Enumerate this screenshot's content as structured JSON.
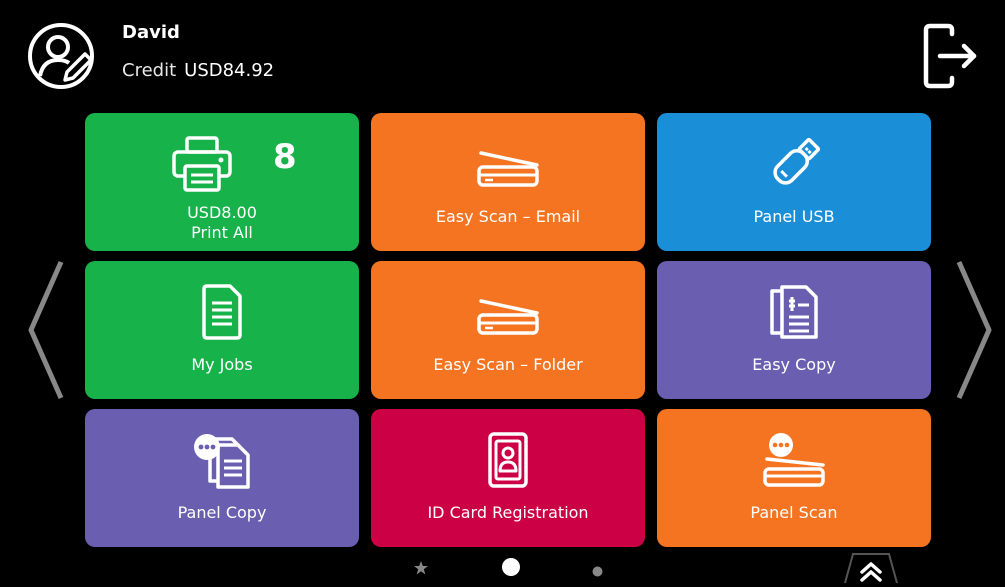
{
  "header": {
    "user_name": "David",
    "credit_label": "Credit",
    "credit_value": "USD84.92",
    "icons": {
      "avatar": "user-edit-icon",
      "logout": "logout-icon"
    }
  },
  "tiles": [
    {
      "id": "print-all",
      "line1": "USD8.00",
      "line2": "Print All",
      "badge": "8",
      "icon": "printer-icon",
      "color": "#17b34a"
    },
    {
      "id": "easy-scan-email",
      "label": "Easy Scan – Email",
      "icon": "scanner-icon",
      "color": "#f47421"
    },
    {
      "id": "panel-usb",
      "label": "Panel USB",
      "icon": "usb-drive-icon",
      "color": "#1b8ed8"
    },
    {
      "id": "my-jobs",
      "label": "My Jobs",
      "icon": "document-icon",
      "color": "#17b34a"
    },
    {
      "id": "easy-scan-folder",
      "label": "Easy Scan – Folder",
      "icon": "scanner-icon",
      "color": "#f47421"
    },
    {
      "id": "easy-copy",
      "label": "Easy Copy",
      "icon": "copy-documents-icon",
      "color": "#6a5eb0"
    },
    {
      "id": "panel-copy",
      "label": "Panel Copy",
      "icon": "copy-more-icon",
      "color": "#6a5eb0"
    },
    {
      "id": "id-card-registration",
      "label": "ID Card Registration",
      "icon": "id-card-icon",
      "color": "#cc0044"
    },
    {
      "id": "panel-scan",
      "label": "Panel Scan",
      "icon": "scan-more-icon",
      "color": "#f47421"
    }
  ],
  "navigation": {
    "prev": "chevron-left-icon",
    "next": "chevron-right-icon",
    "pages": [
      "star-icon",
      "dot-active",
      "dot"
    ],
    "expand": "double-chevron-up-icon"
  }
}
